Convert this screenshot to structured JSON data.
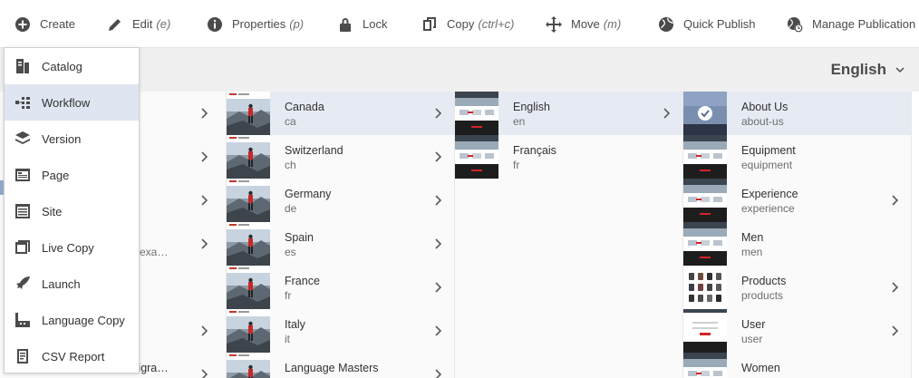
{
  "toolbar": {
    "create": "Create",
    "edit": "Edit",
    "edit_sc": "(e)",
    "properties": "Properties",
    "properties_sc": "(p)",
    "lock": "Lock",
    "copy": "Copy",
    "copy_sc": "(ctrl+c)",
    "move": "Move",
    "move_sc": "(m)",
    "quick_publish": "Quick Publish",
    "manage_publication": "Manage Publication"
  },
  "header": {
    "language": "English"
  },
  "menu": {
    "items": [
      {
        "label": "Catalog",
        "icon": "catalog-icon"
      },
      {
        "label": "Workflow",
        "icon": "workflow-icon"
      },
      {
        "label": "Version",
        "icon": "version-icon"
      },
      {
        "label": "Page",
        "icon": "page-icon"
      },
      {
        "label": "Site",
        "icon": "site-icon"
      },
      {
        "label": "Live Copy",
        "icon": "live-copy-icon"
      },
      {
        "label": "Launch",
        "icon": "launch-icon"
      },
      {
        "label": "Language Copy",
        "icon": "language-copy-icon"
      },
      {
        "label": "CSV Report",
        "icon": "csv-report-icon"
      }
    ]
  },
  "col0": {
    "rows": [
      {
        "title": "",
        "sub": ""
      },
      {
        "title": "",
        "sub": ""
      },
      {
        "title": "",
        "sub": ""
      },
      {
        "title": "s",
        "sub": "—exa…"
      },
      {
        "title": "",
        "sub": ""
      },
      {
        "title": "",
        "sub": ""
      },
      {
        "title": "Migra…",
        "sub": ""
      }
    ]
  },
  "col1": {
    "rows": [
      {
        "title": "Canada",
        "sub": "ca"
      },
      {
        "title": "Switzerland",
        "sub": "ch"
      },
      {
        "title": "Germany",
        "sub": "de"
      },
      {
        "title": "Spain",
        "sub": "es"
      },
      {
        "title": "France",
        "sub": "fr"
      },
      {
        "title": "Italy",
        "sub": "it"
      },
      {
        "title": "Language Masters",
        "sub": ""
      }
    ]
  },
  "col2": {
    "rows": [
      {
        "title": "English",
        "sub": "en"
      },
      {
        "title": "Français",
        "sub": "fr"
      }
    ]
  },
  "col3": {
    "rows": [
      {
        "title": "About Us",
        "sub": "about-us"
      },
      {
        "title": "Equipment",
        "sub": "equipment"
      },
      {
        "title": "Experience",
        "sub": "experience"
      },
      {
        "title": "Men",
        "sub": "men"
      },
      {
        "title": "Products",
        "sub": "products"
      },
      {
        "title": "User",
        "sub": "user"
      },
      {
        "title": "Women",
        "sub": ""
      }
    ]
  },
  "colors": {
    "selected_row": "#e6eaf3",
    "menu_highlight": "#dfe6f1",
    "accent_red": "#d3232b"
  }
}
